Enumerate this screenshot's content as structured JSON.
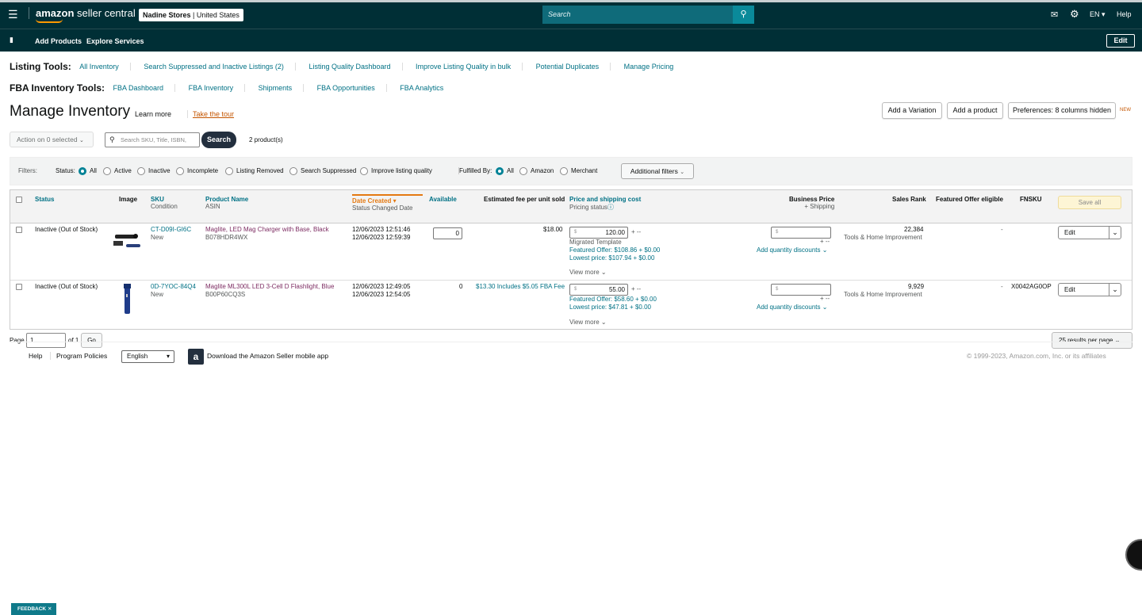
{
  "topbar": {
    "brand_bold": "amazon",
    "brand_rest": " seller central",
    "store_name": "Nadine Stores",
    "store_region": "United States",
    "search_placeholder": "Search",
    "lang": "EN",
    "help": "Help"
  },
  "subbar": {
    "add_products": "Add Products",
    "explore_services": "Explore Services",
    "edit": "Edit"
  },
  "listing_tools": {
    "label": "Listing Tools:",
    "links": [
      "All Inventory",
      "Search Suppressed and Inactive Listings (2)",
      "Listing Quality Dashboard",
      "Improve Listing Quality in bulk",
      "Potential Duplicates",
      "Manage Pricing"
    ]
  },
  "fba_tools": {
    "label": "FBA Inventory Tools:",
    "links": [
      "FBA Dashboard",
      "FBA Inventory",
      "Shipments",
      "FBA Opportunities",
      "FBA Analytics"
    ]
  },
  "page": {
    "title": "Manage Inventory",
    "learn_more": "Learn more",
    "take_tour": "Take the tour",
    "add_variation": "Add a Variation",
    "add_product": "Add a product",
    "preferences": "Preferences: 8 columns hidden",
    "new_tag": "NEW",
    "action": "Action on 0 selected",
    "search_placeholder": "Search SKU, Title, ISBN,",
    "search_btn": "Search",
    "count": "2 product(s)"
  },
  "filters": {
    "label": "Filters:",
    "status_label": "Status:",
    "status_options": [
      "All",
      "Active",
      "Inactive",
      "Incomplete",
      "Listing Removed",
      "Search Suppressed",
      "Improve listing quality"
    ],
    "fulfilled_label": "Fulfilled By:",
    "fulfilled_options": [
      "All",
      "Amazon",
      "Merchant"
    ],
    "additional": "Additional filters"
  },
  "columns": {
    "status": "Status",
    "image": "Image",
    "sku": "SKU",
    "condition": "Condition",
    "product_name": "Product Name",
    "asin": "ASIN",
    "date_created": "Date Created",
    "status_changed": "Status Changed Date",
    "available": "Available",
    "est_fee": "Estimated fee per unit sold",
    "price_shipping": "Price and shipping cost",
    "pricing_status": "Pricing status",
    "business_price": "Business Price",
    "plus_shipping": "+ Shipping",
    "sales_rank": "Sales Rank",
    "featured_offer": "Featured Offer eligible",
    "fnsku": "FNSKU",
    "save_all": "Save all"
  },
  "rows": [
    {
      "status": "Inactive (Out of Stock)",
      "sku": "CT-D09I-GI6C",
      "condition": "New",
      "name": "Maglite, LED Mag Charger with Base, Black",
      "asin": "B078HDR4WX",
      "created": "12/06/2023 12:51:46",
      "changed": "12/06/2023 12:59:39",
      "available": "0",
      "fee": "$18.00",
      "price": "120.00",
      "plus": "+ --",
      "template": "Migrated Template",
      "featured": "Featured Offer: $108.86 + $0.00",
      "lowest": "Lowest price: $107.94 + $0.00",
      "view_more": "View more",
      "biz_plus": "+ --",
      "qty_disc": "Add quantity discounts",
      "rank": "22,384",
      "rank_cat": "Tools & Home Improvement",
      "featured_eligible": "-",
      "fnsku": "",
      "edit": "Edit"
    },
    {
      "status": "Inactive (Out of Stock)",
      "sku": "0D-7YOC-84Q4",
      "condition": "New",
      "name": "Maglite ML300L LED 3-Cell D Flashlight, Blue",
      "asin": "B00P60CQ3S",
      "created": "12/06/2023 12:49:05",
      "changed": "12/06/2023 12:54:05",
      "available": "0",
      "fee": "$13.30 Includes $5.05 FBA Fee",
      "price": "55.00",
      "plus": "+ --",
      "template": "",
      "featured": "Featured Offer: $58.60 + $0.00",
      "lowest": "Lowest price: $47.81 + $0.00",
      "view_more": "View more",
      "biz_plus": "+ --",
      "qty_disc": "Add quantity discounts",
      "rank": "9,929",
      "rank_cat": "Tools & Home Improvement",
      "featured_eligible": "-",
      "fnsku": "X0042AG0OP",
      "edit": "Edit"
    }
  ],
  "pager": {
    "page_label": "Page",
    "page_value": "1",
    "of": "of 1",
    "go": "Go",
    "per_page": "25 results per page"
  },
  "footer": {
    "help": "Help",
    "policies": "Program Policies",
    "language": "English",
    "app": "Download the Amazon Seller mobile app",
    "copyright": "© 1999-2023, Amazon.com, Inc. or its affiliates"
  },
  "feedback": "FEEDBACK",
  "colors": {
    "header": "#002f36",
    "link": "#007185",
    "accent": "#e47911",
    "product": "#7d2c62"
  }
}
